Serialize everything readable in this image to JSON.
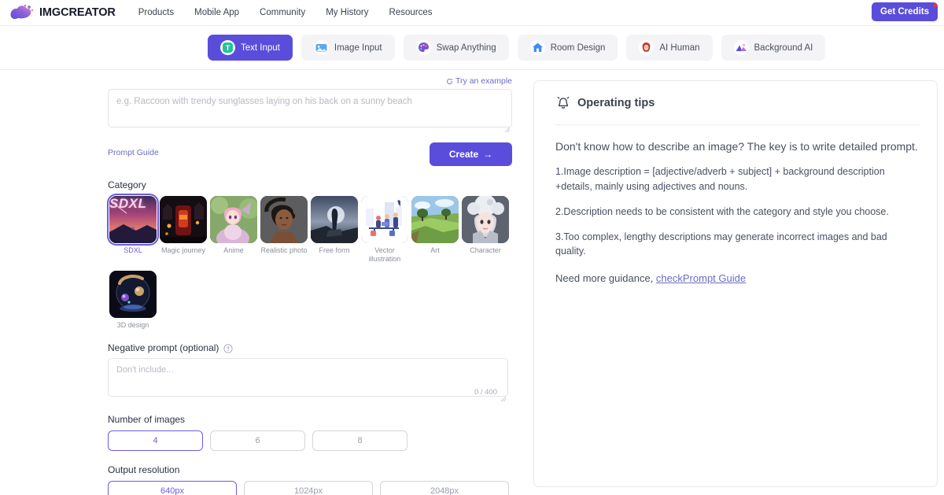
{
  "brand": {
    "name": "IMGCREATOR"
  },
  "nav": {
    "links": [
      {
        "label": "Products"
      },
      {
        "label": "Mobile App"
      },
      {
        "label": "Community"
      },
      {
        "label": "My History"
      },
      {
        "label": "Resources"
      }
    ],
    "credits_button": "Get Credits"
  },
  "tabs": [
    {
      "label": "Text Input",
      "icon": "text-input-icon",
      "active": true
    },
    {
      "label": "Image Input",
      "icon": "image-input-icon",
      "active": false
    },
    {
      "label": "Swap Anything",
      "icon": "palette-icon",
      "active": false
    },
    {
      "label": "Room Design",
      "icon": "house-icon",
      "active": false
    },
    {
      "label": "AI Human",
      "icon": "person-icon",
      "active": false
    },
    {
      "label": "Background AI",
      "icon": "mountain-icon",
      "active": false
    }
  ],
  "prompt": {
    "try_example": "Try an example",
    "placeholder": "e.g. Raccoon with trendy sunglasses laying on his back on a sunny beach",
    "value": "",
    "guide_link": "Prompt Guide",
    "create_button": "Create",
    "create_arrow": "→"
  },
  "category": {
    "label": "Category",
    "items": [
      {
        "name": "SDXL",
        "selected": true
      },
      {
        "name": "Magic journey",
        "selected": false
      },
      {
        "name": "Anime",
        "selected": false
      },
      {
        "name": "Realistic photo",
        "selected": false
      },
      {
        "name": "Free form",
        "selected": false
      },
      {
        "name": "Vector illustration",
        "selected": false
      },
      {
        "name": "Art",
        "selected": false
      },
      {
        "name": "Character",
        "selected": false
      },
      {
        "name": "3D design",
        "selected": false
      }
    ]
  },
  "negative_prompt": {
    "label": "Negative prompt (optional)",
    "placeholder": "Don't include...",
    "value": "",
    "counter": "0 / 400"
  },
  "number_of_images": {
    "label": "Number of images",
    "options": [
      {
        "label": "4",
        "selected": true
      },
      {
        "label": "6",
        "selected": false
      },
      {
        "label": "8",
        "selected": false
      }
    ]
  },
  "output_resolution": {
    "label": "Output resolution",
    "options": [
      {
        "label": "640px",
        "selected": true
      },
      {
        "label": "1024px",
        "selected": false
      },
      {
        "label": "2048px",
        "selected": false
      }
    ]
  },
  "tips": {
    "title": "Operating tips",
    "lead": "Don't know how to describe an image? The key is to write detailed prompt.",
    "item1": "1.Image description = [adjective/adverb + subject] + background description +details, mainly using adjectives and nouns.",
    "item2": "2.Description needs to be consistent with the category and style you choose.",
    "item3": "3.Too complex, lengthy descriptions may generate incorrect images and bad quality.",
    "footer_text": "Need more guidance, ",
    "footer_link": "checkPrompt Guide"
  },
  "colors": {
    "accent": "#5b4ddb",
    "accent_light": "#6b5ce0",
    "link": "#6a6dc4",
    "text": "#2c3245",
    "muted": "#8b8f9e",
    "badge": "#ff2d2d"
  }
}
